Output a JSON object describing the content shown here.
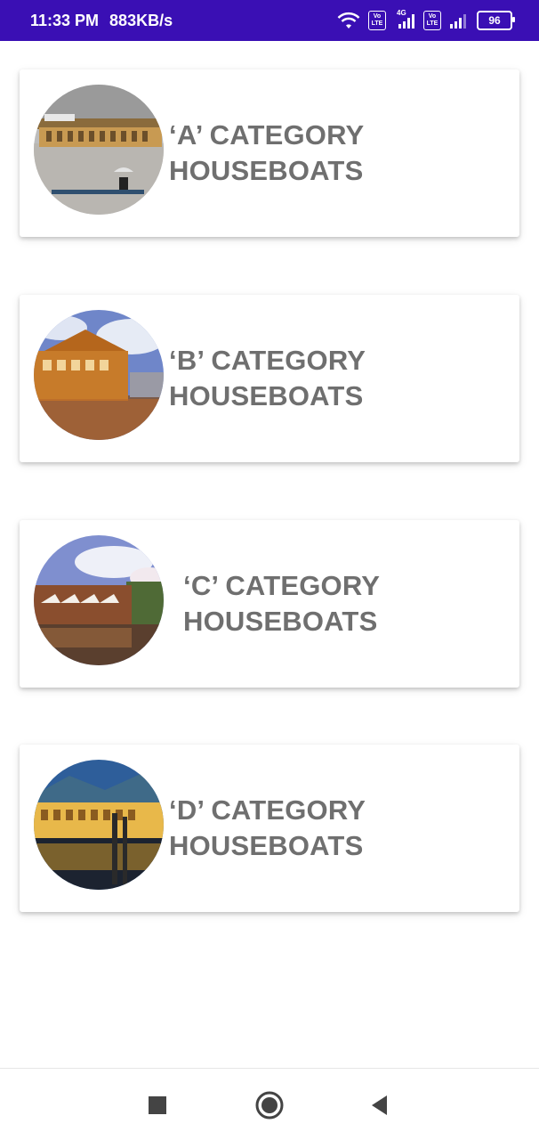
{
  "status_bar": {
    "time": "11:33 PM",
    "net_speed": "883KB/s",
    "network_type": "4G",
    "volte_label_top": "Vo",
    "volte_label_bottom": "LTE",
    "battery": "96",
    "icons": [
      "wifi-icon",
      "volte-icon",
      "signal-icon",
      "volte-icon",
      "signal-icon",
      "battery-icon"
    ],
    "background": "#3a0fb4"
  },
  "categories": [
    {
      "title": "‘A’ CATEGORY\nHOUSEBOATS"
    },
    {
      "title": "‘B’ CATEGORY\nHOUSEBOATS"
    },
    {
      "title": "‘C’ CATEGORY\nHOUSEBOATS"
    },
    {
      "title": "‘D’ CATEGORY\nHOUSEBOATS"
    }
  ],
  "nav_bar": {
    "icons": [
      "recents-square-icon",
      "home-circle-icon",
      "back-triangle-icon"
    ]
  },
  "colors": {
    "title_text": "#6f6f6f",
    "accent": "#3a0fb4"
  }
}
